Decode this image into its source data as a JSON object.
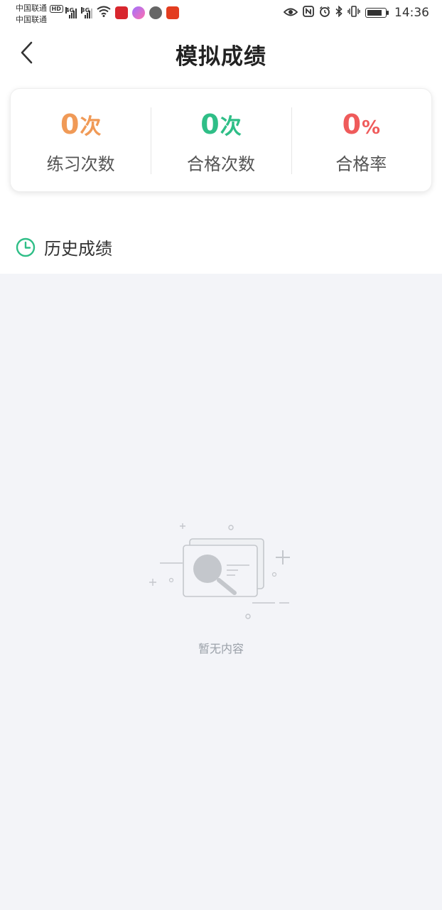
{
  "status_bar": {
    "carrier_1": "中国联通",
    "carrier_2": "中国联通",
    "hd_badge": "HD",
    "net_1": "4G",
    "net_2": "3G",
    "time": "14:36"
  },
  "header": {
    "title": "模拟成绩"
  },
  "stats": [
    {
      "value": "0",
      "unit": "次",
      "label": "练习次数",
      "color": "#f09a57"
    },
    {
      "value": "0",
      "unit": "次",
      "label": "合格次数",
      "color": "#2fbe87"
    },
    {
      "value": "0",
      "unit": "%",
      "label": "合格率",
      "color": "#ef5b5b"
    }
  ],
  "history": {
    "label": "历史成绩",
    "icon": "clock-icon",
    "accent": "#2fbe87"
  },
  "empty_state": {
    "text": "暂无内容",
    "icon": "empty-search-illustration"
  }
}
